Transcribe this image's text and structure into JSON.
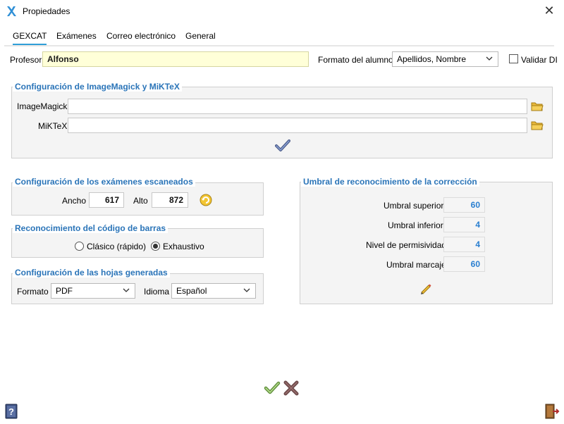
{
  "window": {
    "title": "Propiedades",
    "close_glyph": "✕"
  },
  "tabs": [
    {
      "label": "GEXCAT",
      "active": true
    },
    {
      "label": "Exámenes",
      "active": false
    },
    {
      "label": "Correo electrónico",
      "active": false
    },
    {
      "label": "General",
      "active": false
    }
  ],
  "profesor": {
    "label": "Profesor",
    "value": "Alfonso"
  },
  "formato_alumno": {
    "label": "Formato del alumno",
    "value": "Apellidos, Nombre"
  },
  "validar": {
    "label": "Validar DI",
    "checked": false
  },
  "imagemagick_group": {
    "title": "Configuración de ImageMagick y MiKTeX",
    "imagemagick_label": "ImageMagick",
    "imagemagick_value": "",
    "miktex_label": "MiKTeX",
    "miktex_value": ""
  },
  "escaneados_group": {
    "title": "Configuración de los exámenes escaneados",
    "ancho_label": "Ancho",
    "ancho_value": "617",
    "alto_label": "Alto",
    "alto_value": "872"
  },
  "barras_group": {
    "title": "Reconocimiento del código de barras",
    "option1": "Clásico (rápido)",
    "option2": "Exhaustivo",
    "selected": "Exhaustivo"
  },
  "hojas_group": {
    "title": "Configuración de las hojas generadas",
    "formato_label": "Formato",
    "formato_value": "PDF",
    "idioma_label": "Idioma",
    "idioma_value": "Español"
  },
  "umbral_group": {
    "title": "Umbral de reconocimiento de la corrección",
    "rows": [
      {
        "label": "Umbral superior",
        "value": "60"
      },
      {
        "label": "Umbral inferior",
        "value": "4"
      },
      {
        "label": "Nivel de permisividad",
        "value": "4"
      },
      {
        "label": "Umbral marcaje",
        "value": "60"
      }
    ]
  },
  "colors": {
    "accent": "#2f9ed8",
    "group_title": "#2a74b8",
    "value_blue": "#2a7fd0",
    "highlight_field": "#ffffd8"
  },
  "icons": [
    "app-x-icon",
    "close-icon",
    "folder-icon",
    "checkmark-icon",
    "refresh-icon",
    "pencil-icon",
    "cross-icon",
    "help-icon",
    "exit-door-icon",
    "chevron-down-icon"
  ]
}
